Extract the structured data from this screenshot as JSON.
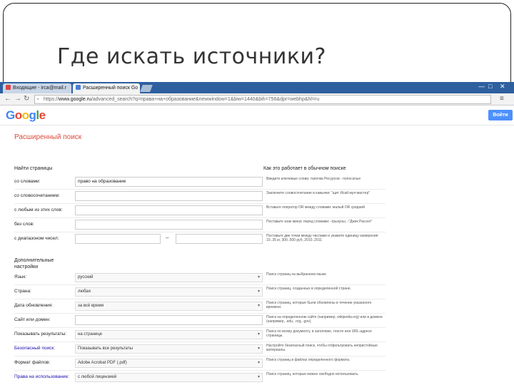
{
  "slide": {
    "title": "Где искать источники?"
  },
  "browser": {
    "tabs": [
      {
        "label": "Входящие - irca@mail.r",
        "active": false
      },
      {
        "label": "Расширенный поиск Go",
        "active": true
      }
    ],
    "url_prefix": "https://",
    "url_host": "www.google.ru",
    "url_rest": "/advanced_search?q=права+на+образование&newwindow=1&biw=1440&bih=756&dpr=webhp&hl=ru"
  },
  "google": {
    "logo": "Google",
    "signin_label": "Войти",
    "page_title": "Расширенный поиск"
  },
  "find_pages": {
    "heading": "Найти страницы",
    "hint_heading": "Как это работает в обычном поиске",
    "rows": [
      {
        "label": "со словами:",
        "value": "право на образование",
        "hint": "Введите ключевые слова: тапочки Ресурсов - полосатые"
      },
      {
        "label": "со словосочетанием:",
        "value": "",
        "hint": "Заключите словосочетание в кавычки: \"щит Исай мул-мастер\""
      },
      {
        "label": "с любым из этих слов:",
        "value": "",
        "hint": "Вставьте оператор OR между словами: малый OR средний"
      },
      {
        "label": "без слов:",
        "value": "",
        "hint": "Поставьте знак минус перед словами: -грызуны, -\"Джек Рассел\""
      },
      {
        "label": "с диапазоном чисел:",
        "value": "",
        "value_to": "",
        "dash": "–",
        "hint": "Поставьте две точки между числами и укажите единицу измерения: 10..35 кг, 300..500 руб, 2010..2011"
      }
    ]
  },
  "refine": {
    "heading_line1": "Дополнительные",
    "heading_line2": "настройки",
    "rows": [
      {
        "label": "Язык:",
        "value": "русский",
        "link": false,
        "hint": "Поиск страниц на выбранном языке."
      },
      {
        "label": "Страна:",
        "value": "любая",
        "link": false,
        "hint": "Поиск страниц, созданных в определенной стране."
      },
      {
        "label": "Дата обновления:",
        "value": "за всё время",
        "link": false,
        "hint": "Поиск страниц, которые были обновлены в течение указанного времени."
      },
      {
        "label": "Сайт или домен:",
        "value": "",
        "link": false,
        "hint": "Поиск на определенном сайте (например, wikipedia.org) или в домене (например, .edu, .org, .gov)."
      },
      {
        "label": "Показывать результаты:",
        "value": "на странице",
        "link": false,
        "hint": "Поиск по всему документу, в заголовке, тексте или URL-адресе страницы."
      },
      {
        "label": "Безопасный поиск:",
        "value": "Показывать все результаты",
        "link": true,
        "hint": "Настройте безопасный поиск, чтобы отфильтровать непристойные материалы."
      },
      {
        "label": "Формат файлов:",
        "value": "Adobe Acrobat PDF (.pdf)",
        "link": false,
        "hint": "Поиск страниц в файлах определенного формата."
      },
      {
        "label": "Права на использование:",
        "value": "с любой лицензией",
        "link": true,
        "hint": "Поиск страниц, которые можно свободно использовать."
      }
    ]
  }
}
